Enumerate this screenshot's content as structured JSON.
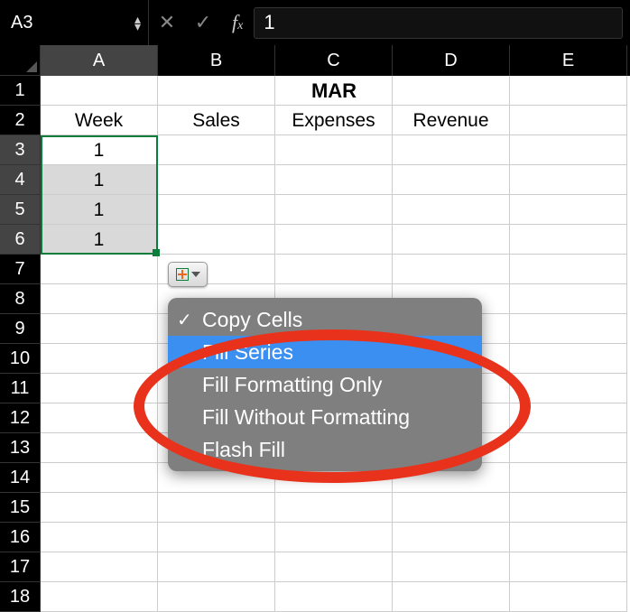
{
  "formula_bar": {
    "name_box": "A3",
    "formula_value": "1"
  },
  "columns": [
    "A",
    "B",
    "C",
    "D",
    "E"
  ],
  "row_numbers": [
    "1",
    "2",
    "3",
    "4",
    "5",
    "6",
    "7",
    "8",
    "9",
    "10",
    "11",
    "12",
    "13",
    "14",
    "15",
    "16",
    "17",
    "18"
  ],
  "title_cell": "MAR",
  "headers_row": [
    "Week",
    "Sales",
    "Expenses",
    "Revenue",
    ""
  ],
  "fill_values": [
    "1",
    "1",
    "1",
    "1"
  ],
  "autofill_menu": {
    "items": [
      {
        "label": "Copy Cells",
        "checked": true,
        "highlight": false
      },
      {
        "label": "Fill Series",
        "checked": false,
        "highlight": true
      },
      {
        "label": "Fill Formatting Only",
        "checked": false,
        "highlight": false
      },
      {
        "label": "Fill Without Formatting",
        "checked": false,
        "highlight": false
      },
      {
        "label": "Flash Fill",
        "checked": false,
        "highlight": false
      }
    ]
  }
}
